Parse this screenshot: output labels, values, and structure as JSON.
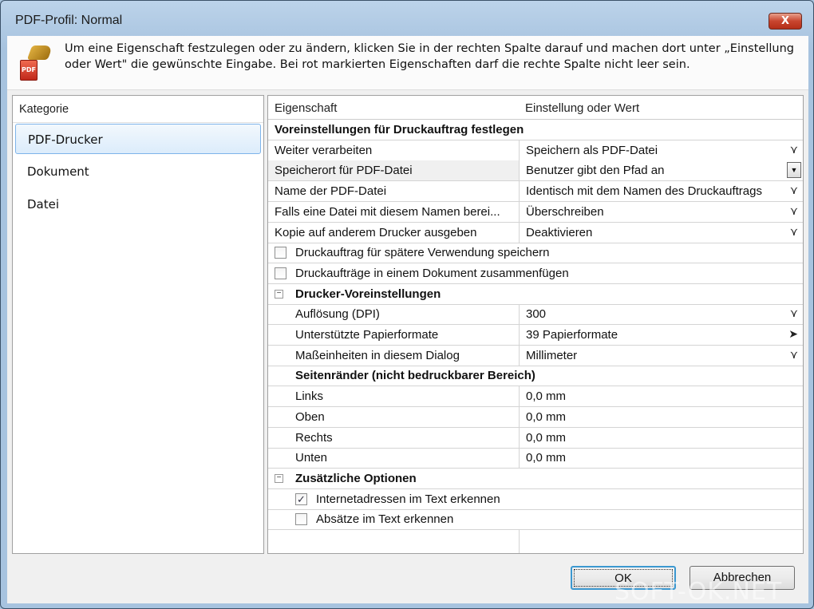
{
  "window": {
    "title": "PDF-Profil: Normal",
    "close_label": "X"
  },
  "info": {
    "text": "Um eine Eigenschaft festzulegen oder zu ändern, klicken Sie in der rechten Spalte darauf und machen dort unter „Einstellung oder Wert\" die gewünschte Eingabe. Bei rot markierten Eigenschaften darf die rechte Spalte nicht leer sein.",
    "icon_label": "PDF"
  },
  "category": {
    "header": "Kategorie",
    "items": [
      {
        "label": "PDF-Drucker",
        "selected": true
      },
      {
        "label": "Dokument"
      },
      {
        "label": "Datei"
      }
    ]
  },
  "grid": {
    "headers": [
      "Eigenschaft",
      "Einstellung oder Wert"
    ],
    "rows": [
      {
        "type": "section",
        "label": "Voreinstellungen für Druckauftrag festlegen"
      },
      {
        "type": "prop",
        "label": "Weiter verarbeiten",
        "value": "Speichern als PDF-Datei",
        "control": "dropdown"
      },
      {
        "type": "prop",
        "label": "Speicherort für PDF-Datei",
        "value": "Benutzer gibt den Pfad an",
        "control": "combo",
        "active": true
      },
      {
        "type": "prop",
        "label": "Name der PDF-Datei",
        "value": "Identisch mit dem Namen des Druckauftrags",
        "control": "dropdown"
      },
      {
        "type": "prop",
        "label": "Falls eine Datei mit diesem Namen berei...",
        "value": "Überschreiben",
        "control": "dropdown"
      },
      {
        "type": "prop",
        "label": "Kopie auf anderem Drucker ausgeben",
        "value": "Deaktivieren",
        "control": "dropdown"
      },
      {
        "type": "check",
        "label": "Druckauftrag für spätere Verwendung speichern",
        "checked": false
      },
      {
        "type": "check",
        "label": "Druckaufträge in einem Dokument zusammenfügen",
        "checked": false
      },
      {
        "type": "group",
        "label": "Drucker-Voreinstellungen",
        "expander": "−"
      },
      {
        "type": "prop",
        "indent": true,
        "label": "Auflösung (DPI)",
        "value": "300",
        "control": "dropdown"
      },
      {
        "type": "prop",
        "indent": true,
        "label": "Unterstützte Papierformate",
        "value": "39 Papierformate",
        "control": "expand"
      },
      {
        "type": "prop",
        "indent": true,
        "label": "Maßeinheiten in diesem Dialog",
        "value": "Millimeter",
        "control": "dropdown"
      },
      {
        "type": "subsection",
        "label": "Seitenränder (nicht bedruckbarer Bereich)"
      },
      {
        "type": "prop",
        "indent": true,
        "label": "Links",
        "value": "0,0 mm"
      },
      {
        "type": "prop",
        "indent": true,
        "label": "Oben",
        "value": "0,0 mm"
      },
      {
        "type": "prop",
        "indent": true,
        "label": "Rechts",
        "value": "0,0 mm"
      },
      {
        "type": "prop",
        "indent": true,
        "label": "Unten",
        "value": "0,0 mm"
      },
      {
        "type": "group",
        "label": "Zusätzliche Optionen",
        "expander": "−"
      },
      {
        "type": "check",
        "indent": true,
        "label": "Internetadressen im Text erkennen",
        "checked": true
      },
      {
        "type": "check",
        "indent": true,
        "label": "Absätze im Text erkennen",
        "checked": false
      }
    ]
  },
  "buttons": {
    "ok": "OK",
    "cancel": "Abbrechen"
  },
  "watermark": "SOFT-OK.NET"
}
